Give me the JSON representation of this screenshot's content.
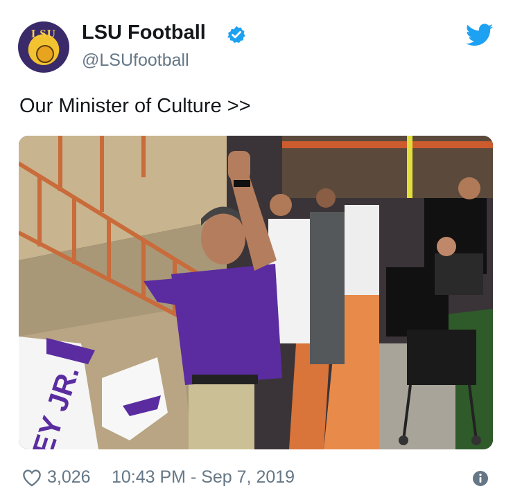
{
  "author": {
    "display_name": "LSU Football",
    "handle": "@LSUfootball",
    "verified": true,
    "avatar_text": "LSU"
  },
  "tweet": {
    "text": "Our Minister of Culture >>"
  },
  "media": {
    "jersey_text": "EY JR."
  },
  "footer": {
    "likes": "3,026",
    "timestamp": "10:43 PM - Sep 7, 2019"
  },
  "icons": {
    "verified": "verified-badge-icon",
    "brand": "twitter-bird-icon",
    "like": "heart-icon",
    "info": "info-icon"
  },
  "colors": {
    "twitter_blue": "#1da1f2",
    "secondary_text": "#657786",
    "lsu_purple": "#5a2ca0",
    "lsu_gold": "#f2c230"
  }
}
